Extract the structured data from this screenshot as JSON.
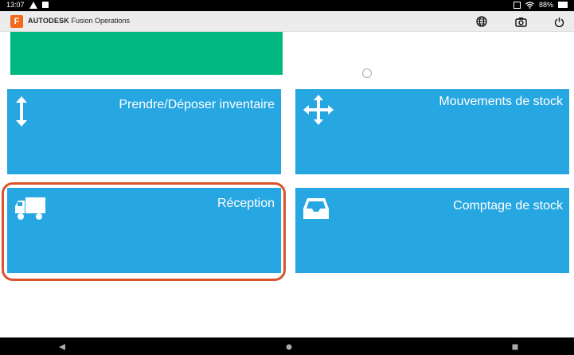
{
  "statusbar": {
    "time": "13:07",
    "battery": "88%"
  },
  "appbar": {
    "logo_letter": "F",
    "brand_bold": "AUTODESK",
    "brand_rest": " Fusion Operations"
  },
  "tiles": [
    {
      "label": "Prendre/Déposer inventaire",
      "icon": "vertical-arrows-icon"
    },
    {
      "label": "Mouvements de stock",
      "icon": "move-arrows-icon"
    },
    {
      "label": "Réception",
      "icon": "truck-icon"
    },
    {
      "label": "Comptage de stock",
      "icon": "inbox-tray-icon"
    }
  ],
  "colors": {
    "tile": "#27a7e2",
    "green": "#00b980",
    "highlight": "#d9542b",
    "logo": "#f26a1b"
  }
}
